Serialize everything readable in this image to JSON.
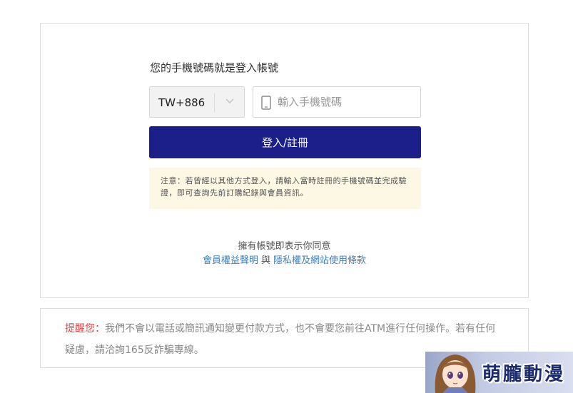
{
  "login": {
    "heading": "您的手機號碼就是登入帳號",
    "country_code": "TW+886",
    "phone_placeholder": "輸入手機號碼",
    "phone_value": "",
    "submit_label": "登入/註冊",
    "notice": "注意：若曾經以其他方式登入，請輸入當時註冊的手機號碼並完成驗證，即可查詢先前訂購紀錄與會員資訊。",
    "terms": {
      "agree_text": "擁有帳號即表示你同意",
      "member_rights_link": "會員權益聲明",
      "and_text": "與",
      "privacy_link": "隱私權及網站使用條款"
    }
  },
  "warning": {
    "label": "提醒您：",
    "text": "我們不會以電話或簡訊通知變更付款方式，也不會要您前往ATM進行任何操作。若有任何疑慮，請洽詢165反詐騙專線。"
  },
  "watermark": {
    "text": "萌朧動漫"
  },
  "icons": {
    "country_dropdown": "chevron-down-icon",
    "phone": "mobile-phone-icon"
  },
  "colors": {
    "primary_button": "#1c1e8a",
    "link": "#3d7fb5",
    "warning_label": "#e04545",
    "notice_background": "#fdf8e4"
  }
}
